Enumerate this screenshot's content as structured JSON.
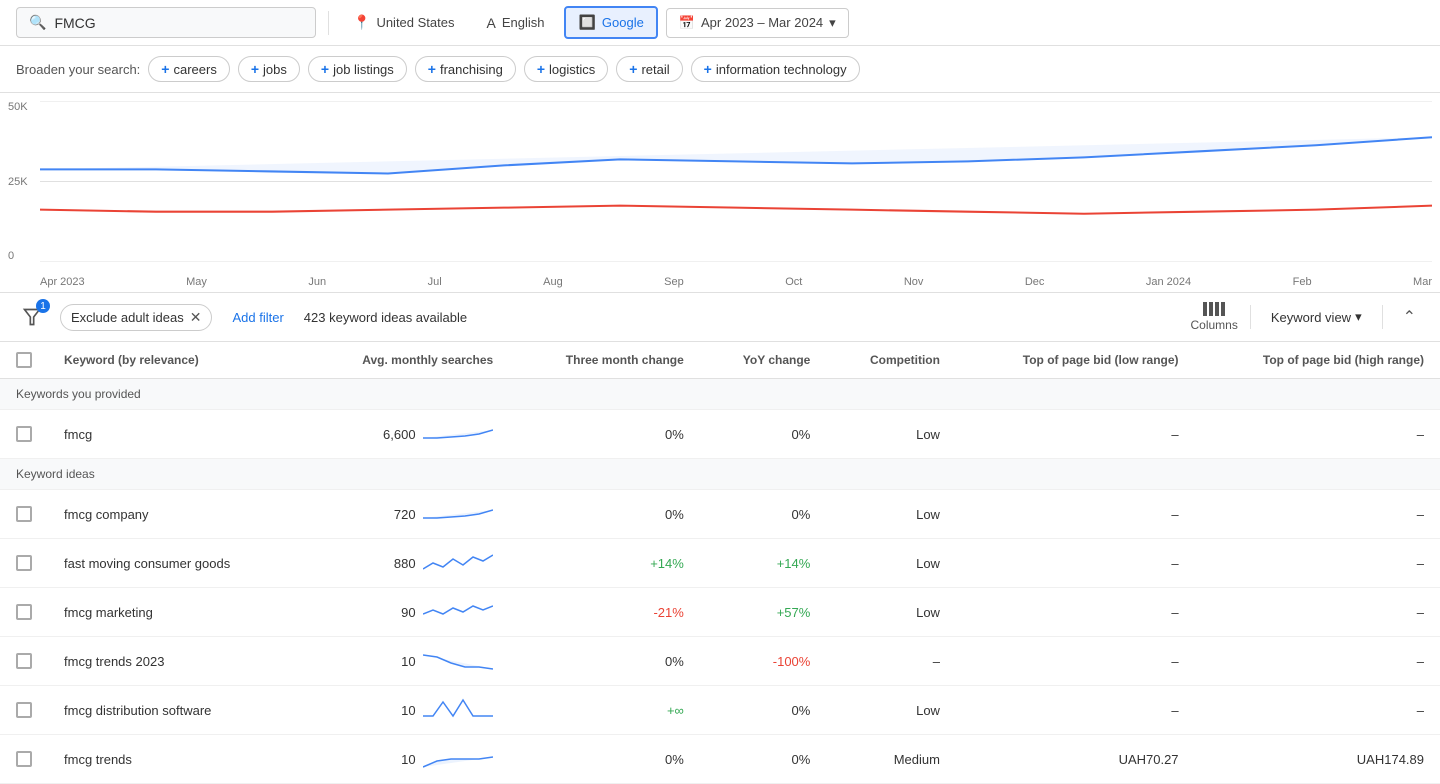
{
  "topBar": {
    "searchValue": "FMCG",
    "location": "United States",
    "language": "English",
    "engine": "Google",
    "dateRange": "Apr 2023 – Mar 2024"
  },
  "broaden": {
    "label": "Broaden your search:",
    "chips": [
      "careers",
      "jobs",
      "job listings",
      "franchising",
      "logistics",
      "retail",
      "information technology"
    ]
  },
  "chart": {
    "yLabels": [
      "50K",
      "25K",
      "0"
    ],
    "xLabels": [
      "Apr 2023",
      "May",
      "Jun",
      "Jul",
      "Aug",
      "Sep",
      "Oct",
      "Nov",
      "Dec",
      "Jan 2024",
      "Feb",
      "Mar"
    ]
  },
  "filterBar": {
    "badgeCount": "1",
    "excludeLabel": "Exclude adult ideas",
    "addFilter": "Add filter",
    "ideasCount": "423 keyword ideas available",
    "columnsLabel": "Columns",
    "keywordViewLabel": "Keyword view"
  },
  "table": {
    "headers": [
      "",
      "Keyword (by relevance)",
      "Avg. monthly searches",
      "Three month change",
      "YoY change",
      "Competition",
      "Top of page bid (low range)",
      "Top of page bid (high range)"
    ],
    "providedSection": "Keywords you provided",
    "ideasSection": "Keyword ideas",
    "rows": [
      {
        "keyword": "fmcg",
        "avgMonthly": "6,600",
        "threeMonth": "0%",
        "yoy": "0%",
        "competition": "Low",
        "bidLow": "–",
        "bidHigh": "–",
        "section": "provided",
        "sparkType": "flat-up"
      },
      {
        "keyword": "fmcg company",
        "avgMonthly": "720",
        "threeMonth": "0%",
        "yoy": "0%",
        "competition": "Low",
        "bidLow": "–",
        "bidHigh": "–",
        "section": "ideas",
        "sparkType": "flat-up"
      },
      {
        "keyword": "fast moving consumer goods",
        "avgMonthly": "880",
        "threeMonth": "+14%",
        "yoy": "+14%",
        "competition": "Low",
        "bidLow": "–",
        "bidHigh": "–",
        "section": "ideas",
        "sparkType": "wavy-up"
      },
      {
        "keyword": "fmcg marketing",
        "avgMonthly": "90",
        "threeMonth": "-21%",
        "yoy": "+57%",
        "competition": "Low",
        "bidLow": "–",
        "bidHigh": "–",
        "section": "ideas",
        "sparkType": "wavy-up2"
      },
      {
        "keyword": "fmcg trends 2023",
        "avgMonthly": "10",
        "threeMonth": "0%",
        "yoy": "-100%",
        "competition": "–",
        "bidLow": "–",
        "bidHigh": "–",
        "section": "ideas",
        "sparkType": "down-flat"
      },
      {
        "keyword": "fmcg distribution software",
        "avgMonthly": "10",
        "threeMonth": "+∞",
        "yoy": "0%",
        "competition": "Low",
        "bidLow": "–",
        "bidHigh": "–",
        "section": "ideas",
        "sparkType": "spiky"
      },
      {
        "keyword": "fmcg trends",
        "avgMonthly": "10",
        "threeMonth": "0%",
        "yoy": "0%",
        "competition": "Medium",
        "bidLow": "UAH70.27",
        "bidHigh": "UAH174.89",
        "section": "ideas",
        "sparkType": "up-flat"
      }
    ]
  }
}
